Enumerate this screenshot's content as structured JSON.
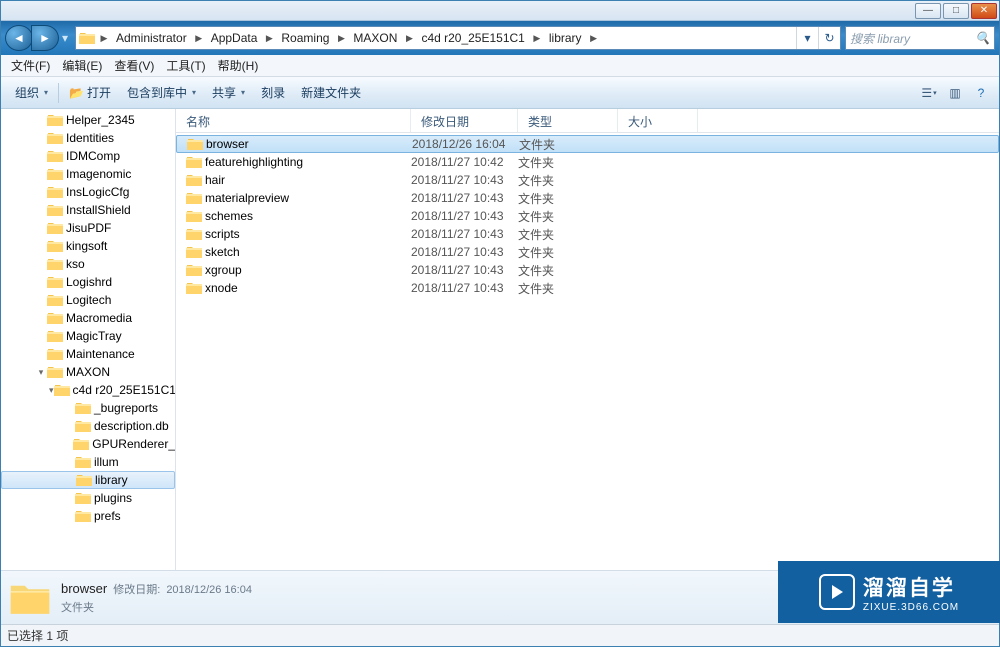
{
  "breadcrumbs": [
    "Administrator",
    "AppData",
    "Roaming",
    "MAXON",
    "c4d r20_25E151C1",
    "library"
  ],
  "search_placeholder": "搜索 library",
  "menus": {
    "file": "文件(F)",
    "edit": "编辑(E)",
    "view": "查看(V)",
    "tools": "工具(T)",
    "help": "帮助(H)"
  },
  "toolbar": {
    "organize": "组织",
    "open": "打开",
    "include": "包含到库中",
    "share": "共享",
    "burn": "刻录",
    "newfolder": "新建文件夹"
  },
  "columns": {
    "name": "名称",
    "date": "修改日期",
    "type": "类型",
    "size": "大小"
  },
  "tree": [
    {
      "ind": 34,
      "exp": "",
      "label": "Helper_2345"
    },
    {
      "ind": 34,
      "exp": "",
      "label": "Identities"
    },
    {
      "ind": 34,
      "exp": "",
      "label": "IDMComp"
    },
    {
      "ind": 34,
      "exp": "",
      "label": "Imagenomic"
    },
    {
      "ind": 34,
      "exp": "",
      "label": "InsLogicCfg"
    },
    {
      "ind": 34,
      "exp": "",
      "label": "InstallShield"
    },
    {
      "ind": 34,
      "exp": "",
      "label": "JisuPDF"
    },
    {
      "ind": 34,
      "exp": "",
      "label": "kingsoft"
    },
    {
      "ind": 34,
      "exp": "",
      "label": "kso"
    },
    {
      "ind": 34,
      "exp": "",
      "label": "Logishrd"
    },
    {
      "ind": 34,
      "exp": "",
      "label": "Logitech"
    },
    {
      "ind": 34,
      "exp": "",
      "label": "Macromedia"
    },
    {
      "ind": 34,
      "exp": "",
      "label": "MagicTray"
    },
    {
      "ind": 34,
      "exp": "",
      "label": "Maintenance"
    },
    {
      "ind": 34,
      "exp": "▾",
      "label": "MAXON"
    },
    {
      "ind": 48,
      "exp": "▾",
      "label": "c4d r20_25E151C1"
    },
    {
      "ind": 62,
      "exp": "",
      "label": "_bugreports"
    },
    {
      "ind": 62,
      "exp": "",
      "label": "description.db"
    },
    {
      "ind": 62,
      "exp": "",
      "label": "GPURenderer_"
    },
    {
      "ind": 62,
      "exp": "",
      "label": "illum"
    },
    {
      "ind": 62,
      "exp": "",
      "label": "library",
      "selected": true
    },
    {
      "ind": 62,
      "exp": "",
      "label": "plugins"
    },
    {
      "ind": 62,
      "exp": "",
      "label": "prefs"
    }
  ],
  "files": [
    {
      "name": "browser",
      "date": "2018/12/26 16:04",
      "type": "文件夹",
      "selected": true
    },
    {
      "name": "featurehighlighting",
      "date": "2018/11/27 10:42",
      "type": "文件夹"
    },
    {
      "name": "hair",
      "date": "2018/11/27 10:43",
      "type": "文件夹"
    },
    {
      "name": "materialpreview",
      "date": "2018/11/27 10:43",
      "type": "文件夹"
    },
    {
      "name": "schemes",
      "date": "2018/11/27 10:43",
      "type": "文件夹"
    },
    {
      "name": "scripts",
      "date": "2018/11/27 10:43",
      "type": "文件夹"
    },
    {
      "name": "sketch",
      "date": "2018/11/27 10:43",
      "type": "文件夹"
    },
    {
      "name": "xgroup",
      "date": "2018/11/27 10:43",
      "type": "文件夹"
    },
    {
      "name": "xnode",
      "date": "2018/11/27 10:43",
      "type": "文件夹"
    }
  ],
  "details": {
    "name": "browser",
    "meta_label": "修改日期:",
    "meta_value": "2018/12/26 16:04",
    "type": "文件夹"
  },
  "status": "已选择 1 项",
  "watermark": {
    "cn": "溜溜自学",
    "url": "ZIXUE.3D66.COM"
  }
}
